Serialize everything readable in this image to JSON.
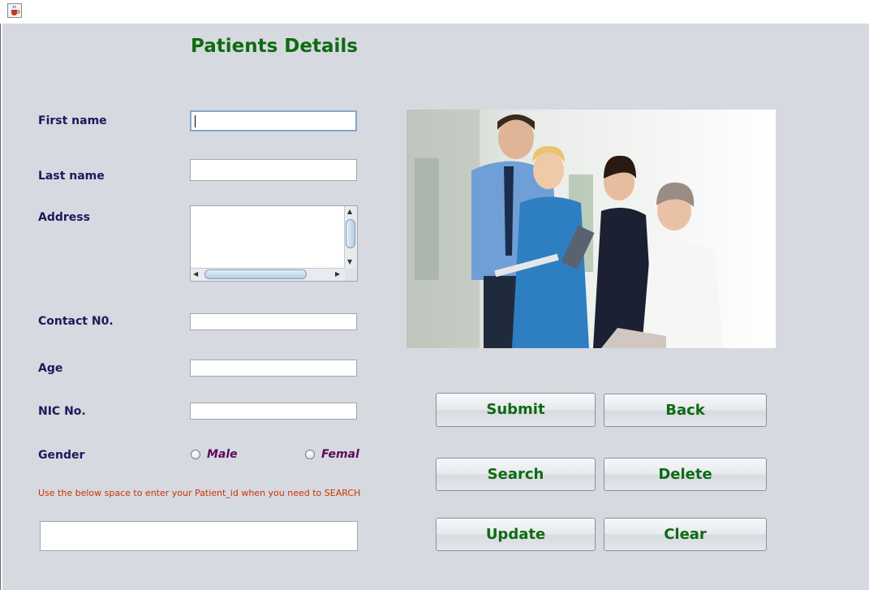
{
  "window": {
    "icon": "java-coffee-icon"
  },
  "page_title": "Patients Details",
  "form": {
    "first_name_label": "First name",
    "last_name_label": "Last name",
    "address_label": "Address",
    "contact_label": "Contact N0.",
    "age_label": "Age",
    "nic_label": "NIC No.",
    "gender_label": "Gender",
    "gender_options": [
      "Male",
      "Female"
    ],
    "first_name_value": "",
    "last_name_value": "",
    "address_value": "",
    "contact_value": "",
    "age_value": "",
    "nic_value": ""
  },
  "search": {
    "hint": "Use the below space to enter your Patient_id when you need to SEARCH",
    "value": ""
  },
  "buttons": {
    "submit": "Submit",
    "back": "Back",
    "search": "Search",
    "delete": "Delete",
    "update": "Update",
    "clear": "Clear"
  },
  "colors": {
    "title": "#0e6b10",
    "label": "#1a1a5c",
    "hint": "#cc3300",
    "radio_label": "#5a0a5a",
    "background": "#d6d9e0"
  }
}
